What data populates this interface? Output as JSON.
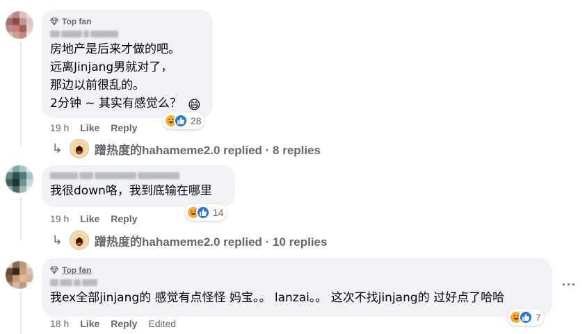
{
  "comments": [
    {
      "badge": "Top fan",
      "lines": "房地产是后来才做的吧。\n远离Jinjang男就对了，\n那边以前很乱的。\n2分钟 ~ 其实有感觉么？",
      "time": "19 h",
      "like": "Like",
      "reply": "Like",
      "reply_label": "Reply",
      "reaction_count": "28",
      "replies_summary": "蹭热度的hahameme2.0 replied · 8 replies"
    },
    {
      "lines": "我很down咯，我到底输在哪里",
      "time": "19 h",
      "like": "Like",
      "reply_label": "Reply",
      "reaction_count": "14",
      "replies_summary": "蹭热度的hahameme2.0 replied · 10 replies"
    },
    {
      "badge": "Top fan",
      "lines": "我ex全部jinjang的 感觉有点怪怪 妈宝。。 lanzai。。 这次不找jinjang的 过好点了哈哈",
      "time": "18 h",
      "like": "Like",
      "reply_label": "Reply",
      "edited": "Edited",
      "reaction_count": "7"
    }
  ],
  "more_menu": "···",
  "reply_arrow": "↳",
  "colors": {
    "bubble": "#f0f2f5",
    "muted": "#65676b",
    "like_blue": "#1877f2",
    "haha_yellow": "#f7b125"
  }
}
